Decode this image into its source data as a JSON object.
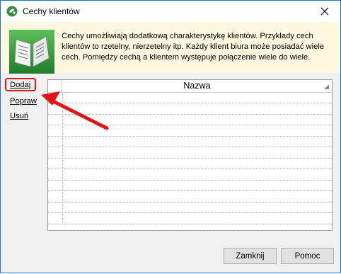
{
  "window": {
    "title": "Cechy klientów"
  },
  "banner": {
    "description": "Cechy umożliwiają dodatkową charakterystykę klientów. Przykłady cech klientów to rzetelny, nierzetelny itp. Każdy klient biura może posiadać wiele cech. Pomiędzy cechą a klientem występuje połączenie wiele do wiele."
  },
  "sidebar": {
    "items": [
      {
        "label": "Dodaj"
      },
      {
        "label": "Popraw"
      },
      {
        "label": "Usuń"
      }
    ]
  },
  "grid": {
    "columns": [
      {
        "label": "Nazwa"
      }
    ],
    "rows": []
  },
  "footer": {
    "close_label": "Zamknij",
    "help_label": "Pomoc"
  },
  "colors": {
    "highlight": "#e01616",
    "banner_bg": "#fff7e0",
    "window_border": "#1a73c9"
  },
  "icons": {
    "app": "app-icon",
    "close": "close-icon",
    "banner": "open-book-icon",
    "annotation": "red-arrow-icon"
  }
}
